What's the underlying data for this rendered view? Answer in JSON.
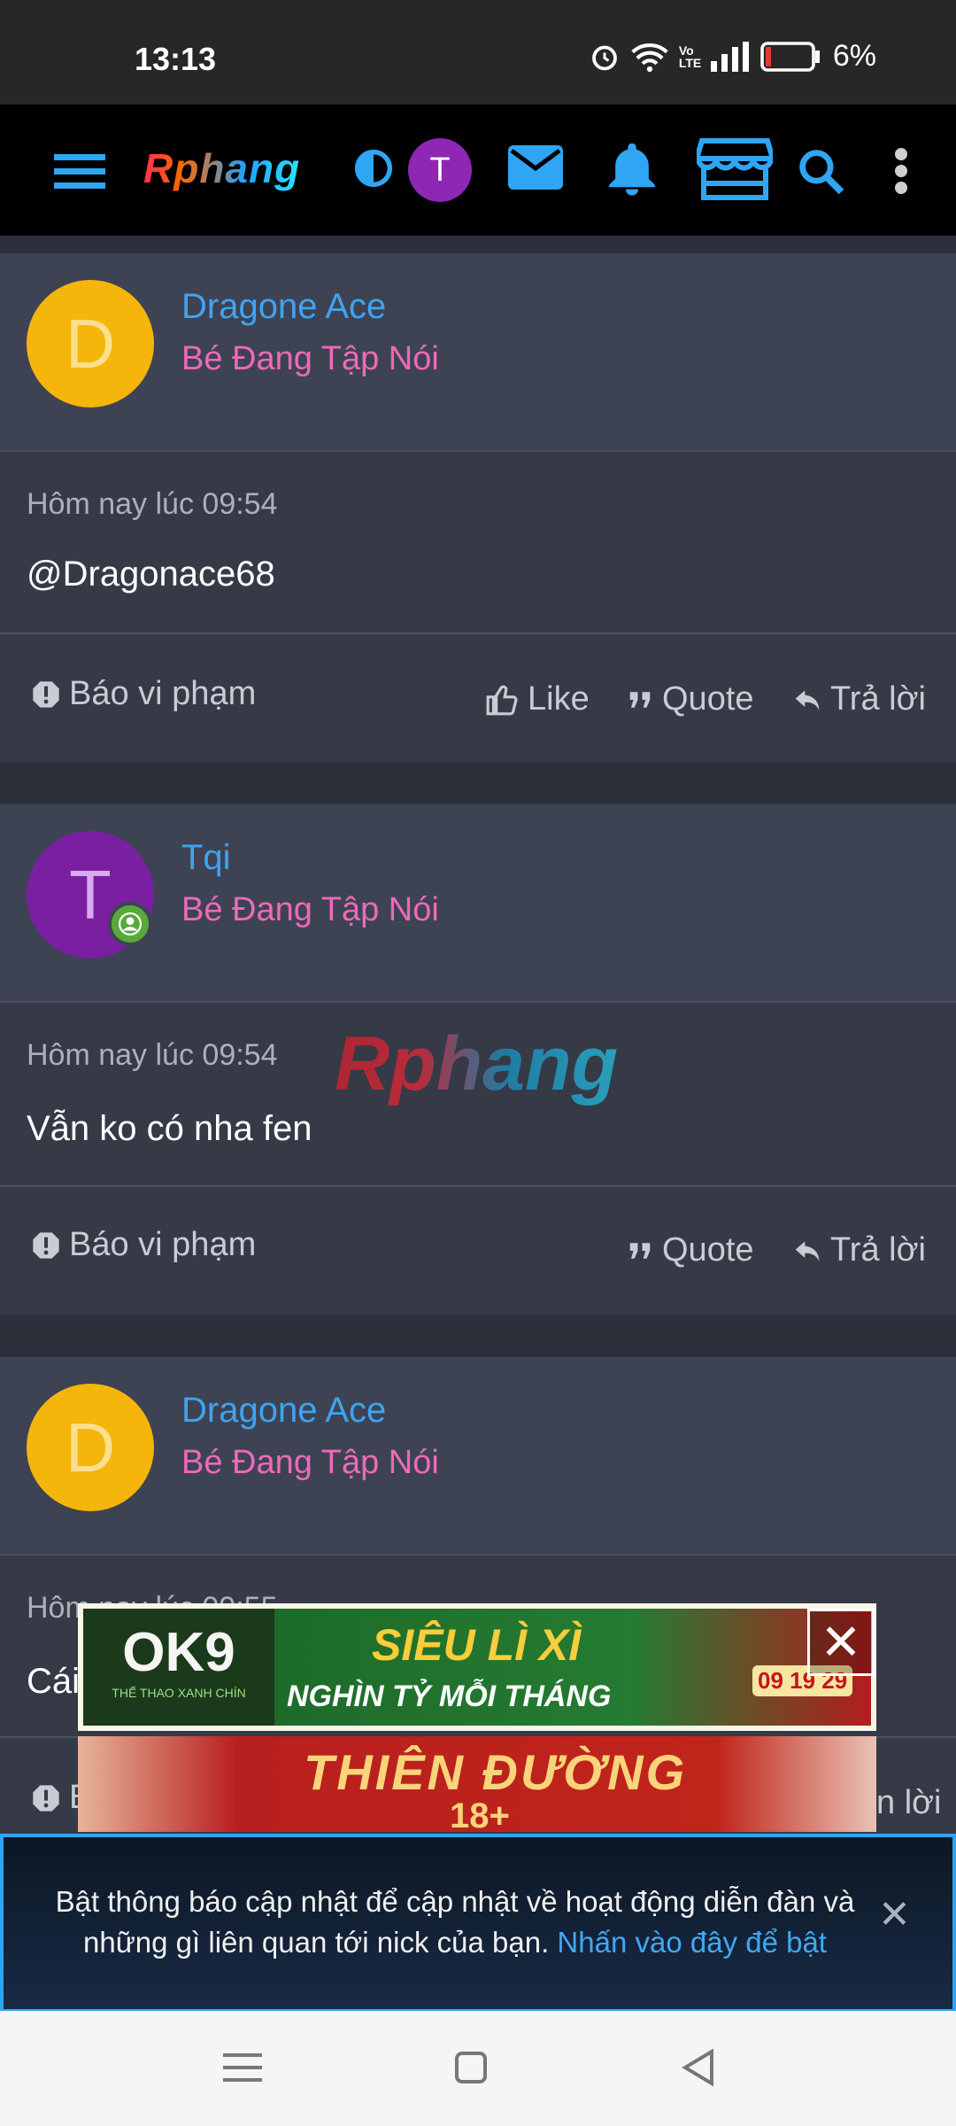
{
  "status_bar": {
    "time": "13:13",
    "battery": "6%",
    "volte": "Vo LTE"
  },
  "navbar": {
    "logo": "Rphang",
    "avatar_letter": "T"
  },
  "posts": [
    {
      "avatar_letter": "D",
      "username": "Dragone Ace",
      "user_title": "Bé Đang Tập Nói",
      "time": "Hôm nay lúc 09:54",
      "message": "@Dragonace68",
      "report_label": "Báo vi phạm",
      "like_label": "Like",
      "quote_label": "Quote",
      "reply_label": "Trả lời"
    },
    {
      "avatar_letter": "T",
      "username": "Tqi",
      "user_title": "Bé Đang Tập Nói",
      "time": "Hôm nay lúc 09:54",
      "message": "Vẫn ko có nha fen",
      "report_label": "Báo vi phạm",
      "quote_label": "Quote",
      "reply_label": "Trả lời"
    },
    {
      "avatar_letter": "D",
      "username": "Dragone Ace",
      "user_title": "Bé Đang Tập Nói",
      "time": "Hôm nay lúc 09:55",
      "message": "Cái",
      "report_label": "B",
      "reply_label": "n lời"
    }
  ],
  "watermark": "Rphang",
  "ad_banner_1": {
    "brand": "OK9",
    "brand_sub": "THỂ THAO XANH CHÍN",
    "headline": "SIÊU LÌ XÌ",
    "subline": "NGHÌN TỶ MỖI THÁNG",
    "dates": "09 19 29",
    "close_symbol": "✕"
  },
  "ad_banner_2": {
    "headline": "THIÊN ĐƯỜNG",
    "subline": "18+"
  },
  "notification": {
    "text": "Bật thông báo cập nhật để cập nhật về hoạt động diễn đàn và những gì liên quan tới nick của bạn.",
    "link": "Nhấn vào đây để bật",
    "close_symbol": "✕"
  }
}
